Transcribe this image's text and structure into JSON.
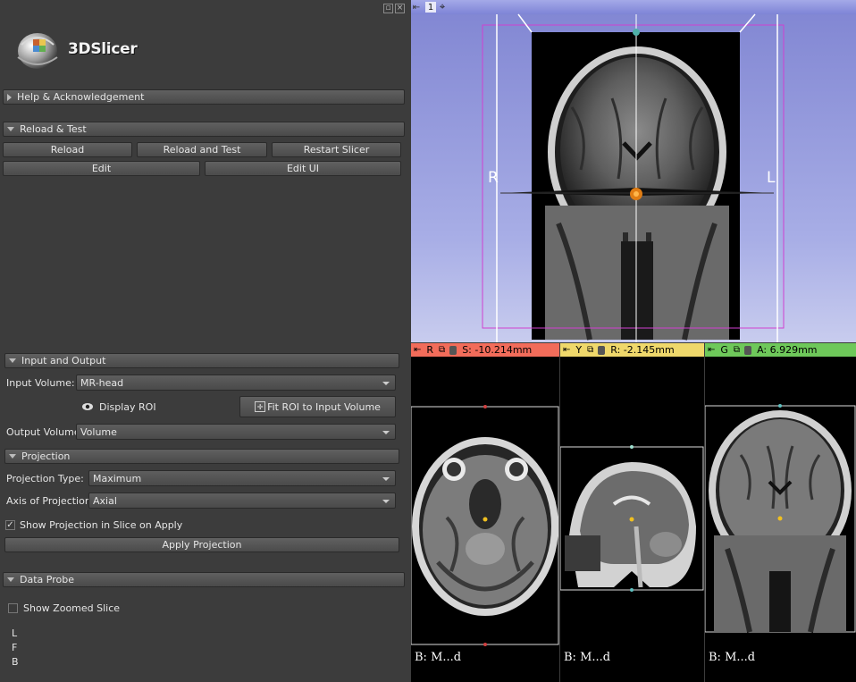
{
  "app": {
    "logo_text": "3DSlicer"
  },
  "sections": {
    "help": "Help & Acknowledgement",
    "reload": "Reload & Test",
    "io": "Input and Output",
    "projection": "Projection",
    "probe": "Data Probe"
  },
  "reload_buttons": {
    "reload": "Reload",
    "reload_test": "Reload and Test",
    "restart": "Restart Slicer",
    "edit": "Edit",
    "edit_ui": "Edit UI"
  },
  "io": {
    "input_label": "Input Volume:",
    "input_value": "MR-head",
    "display_roi": "Display ROI",
    "fit_roi": "Fit ROI to Input Volume",
    "output_label": "Output Volume:",
    "output_value": "Volume"
  },
  "projection": {
    "type_label": "Projection Type:",
    "type_value": "Maximum",
    "axis_label": "Axis of Projection:",
    "axis_value": "Axial",
    "show_in_slice": "Show Projection in Slice on Apply",
    "apply": "Apply Projection"
  },
  "probe": {
    "zoomed": "Show Zoomed Slice",
    "l": "L",
    "f": "F",
    "b": "B"
  },
  "view3d": {
    "number": "1",
    "label_r": "R",
    "label_l": "L"
  },
  "slices": [
    {
      "letter": "R",
      "coord": "S: -10.214mm",
      "bg": "B: M...d",
      "color": "#f26c5a"
    },
    {
      "letter": "Y",
      "coord": "R: -2.145mm",
      "bg": "B: M...d",
      "color": "#efd86b"
    },
    {
      "letter": "G",
      "coord": "A: 6.929mm",
      "bg": "B: M...d",
      "color": "#6ec85a"
    }
  ],
  "colors": {
    "panel_bg": "#3c3c3c",
    "view3d_bg": "#8a8fd8",
    "roi_box": "#d040d0",
    "red": "#f26c5a",
    "yellow": "#efd86b",
    "green": "#6ec85a"
  }
}
